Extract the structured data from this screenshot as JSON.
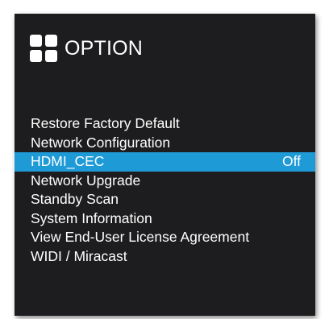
{
  "header": {
    "icon": "grid-icon",
    "title": "OPTION"
  },
  "menu": {
    "selected_color": "#1e9ad6",
    "items": [
      {
        "label": "Restore Factory Default",
        "value": ""
      },
      {
        "label": "Network Configuration",
        "value": ""
      },
      {
        "label": "HDMI_CEC",
        "value": "Off",
        "selected": true
      },
      {
        "label": "Network Upgrade",
        "value": ""
      },
      {
        "label": "Standby Scan",
        "value": ""
      },
      {
        "label": "System Information",
        "value": ""
      },
      {
        "label": "View End-User License Agreement",
        "value": ""
      },
      {
        "label": "WIDI / Miracast",
        "value": ""
      }
    ]
  }
}
